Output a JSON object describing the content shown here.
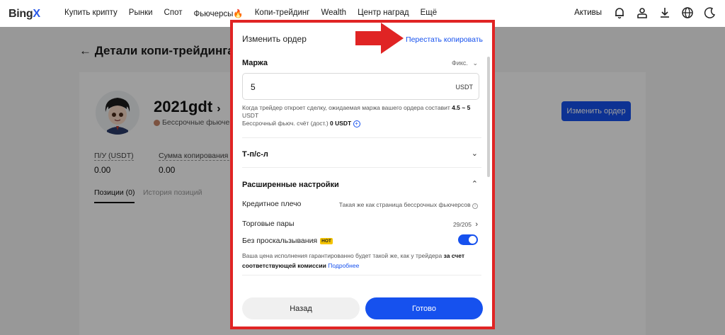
{
  "nav": {
    "logo_main": "Bing",
    "logo_x": "X",
    "items": [
      "Купить крипту",
      "Рынки",
      "Спот",
      "Фьючерсы🔥",
      "Копи-трейдинг",
      "Wealth",
      "Центр наград",
      "Ещё"
    ],
    "assets_label": "Активы",
    "icons": [
      "bell-icon",
      "user-icon",
      "download-icon",
      "globe-icon",
      "moon-icon"
    ]
  },
  "page": {
    "back_arrow": "←",
    "title": "Детали копи-трейдинга",
    "trader_name": "2021gdt",
    "name_chevron": "›",
    "trader_sub": "Бессрочные фьючерс",
    "stats": [
      {
        "label": "П/У (USDT)",
        "value": "0.00"
      },
      {
        "label": "Сумма копирования (",
        "value": "0.00"
      }
    ],
    "tabs": [
      "Позиции (0)",
      "История позиций"
    ],
    "edit_order_button": "Изменить ордер"
  },
  "modal": {
    "title": "Изменить ордер",
    "stop_copy_link": "Перестать копировать",
    "margin": {
      "title": "Маржа",
      "mode_select": "Фикс.",
      "input_value": "5",
      "unit": "USDT",
      "hint_prefix": "Когда трейдер откроет сделку, ожидаемая маржа вашего ордера составит ",
      "hint_range": "4.5 ~ 5",
      "hint_unit": "USDT",
      "balance_prefix": "Бессрочный фьюч. счёт (дост.) ",
      "balance_value": "0 USDT"
    },
    "tpsl_title": "Т-п/с-л",
    "advanced": {
      "title": "Расширенные настройки",
      "leverage_label": "Кредитное плечо",
      "leverage_value": "Такая же как страница бессрочных фьючерсов",
      "pairs_label": "Торговые пары",
      "pairs_value": "29/205",
      "slippage_label": "Без проскальзывания",
      "hot_badge": "HOT",
      "slippage_enabled": true,
      "slippage_hint_prefix": "Ваша цена исполнения гарантированно будет такой же, как у трейдера ",
      "slippage_hint_bold": "за счет соответствующей комиссии",
      "slippage_hint_link": "Подробнее"
    },
    "back_button": "Назад",
    "done_button": "Готово"
  },
  "colors": {
    "accent": "#1651ee",
    "annotation_red": "#e02424",
    "hot_badge": "#f5c400"
  }
}
